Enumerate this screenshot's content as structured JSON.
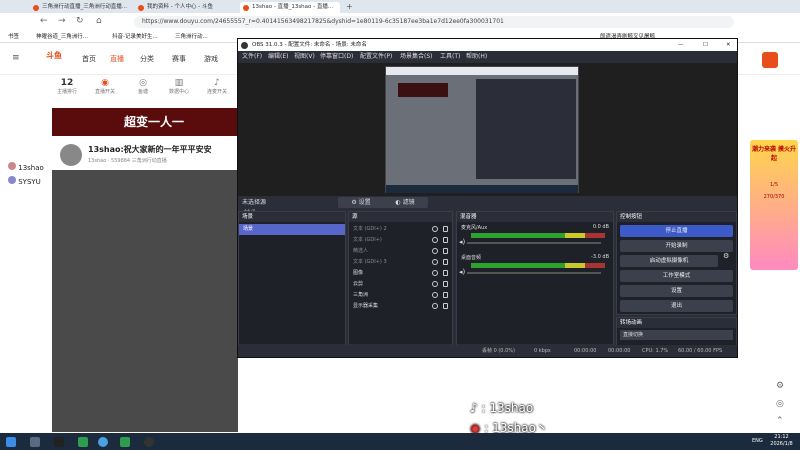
{
  "browser": {
    "tabs": [
      {
        "label": "三角洲行动直播_三角洲行动直播..."
      },
      {
        "label": "我的资料 - 个人中心 - 斗鱼"
      },
      {
        "label": "13shao - 直播_13shao - 直播..."
      }
    ],
    "url": "https://www.douyu.com/24655557_r=0.40141563498217825&dyshid=1e80119-6c35187ee3ba1e7d12ee0fa300031701",
    "bookmarks": [
      "书签",
      "神曜谷道_三角洲行...",
      "抖音-记录美好生...",
      "三角洲行动..."
    ],
    "right_bookmark": "郎遣渴弄刷鲸叉见屠鲸"
  },
  "site": {
    "logo": "斗鱼",
    "nav": [
      "首页",
      "直播",
      "分类",
      "赛事",
      "游戏"
    ],
    "stats": [
      {
        "value": "12",
        "label": "主播排行"
      },
      {
        "label": "直播开关"
      },
      {
        "label": "鱼塘"
      },
      {
        "label": "数据中心"
      },
      {
        "label": "连麦开关"
      }
    ],
    "banner_title": "超变一人一",
    "streamer_title": "13shao:祝大家新的一年平平安安",
    "streamer_meta": "13shao  ·  559884  三角洲行动直播",
    "sidebar_users": [
      "13shao",
      "SYSYU"
    ],
    "ad_text": "潮力来袭 摸火升起",
    "ad_values": [
      "1/5",
      "270/370"
    ],
    "tiktok_line1": "13shao",
    "tiktok_line2": "13shao丶"
  },
  "obs": {
    "title": "OBS 31.0.3 - 配置文件: 未命名 - 场景: 未命名",
    "menu": [
      "文件(F)",
      "编辑(E)",
      "视图(V)",
      "停靠窗口(D)",
      "配置文件(P)",
      "场景集合(S)",
      "工具(T)",
      "帮助(H)"
    ],
    "preview_zoom": "22%",
    "no_source": "未选择源",
    "props_btn": "设置",
    "filters_btn": "滤镜",
    "scenes_header": "场景",
    "scenes": [
      "场景"
    ],
    "sources_header": "源",
    "sources": [
      "文本 (GDI+) 2",
      "文本 (GDI+)",
      "精选人",
      "文本 (GDI+) 3",
      "图像",
      "云剪",
      "三角洲",
      "显示器采集"
    ],
    "mixer_header": "混音器",
    "mixer": [
      {
        "name": "麦克风/Aux",
        "db": "0.0 dB"
      },
      {
        "name": "桌面音频",
        "db": "-3.0 dB"
      }
    ],
    "controls_header": "控制按钮",
    "controls": [
      "停止直播",
      "开始录制",
      "启动虚拟摄像机",
      "工作室模式",
      "设置",
      "退出"
    ],
    "transitions_header": "转场动画",
    "transition": "直接切换",
    "status": {
      "dropped": "丢帧 0 (0.0%)",
      "kbps": "0 kbps",
      "time1": "00:00:00",
      "time2": "00:00:00",
      "cpu": "CPU: 1.7%",
      "fps": "60.00 / 60.00 FPS"
    }
  },
  "taskbar": {
    "lang": "ENG",
    "time": "21:12",
    "date": "2026/1/8"
  }
}
